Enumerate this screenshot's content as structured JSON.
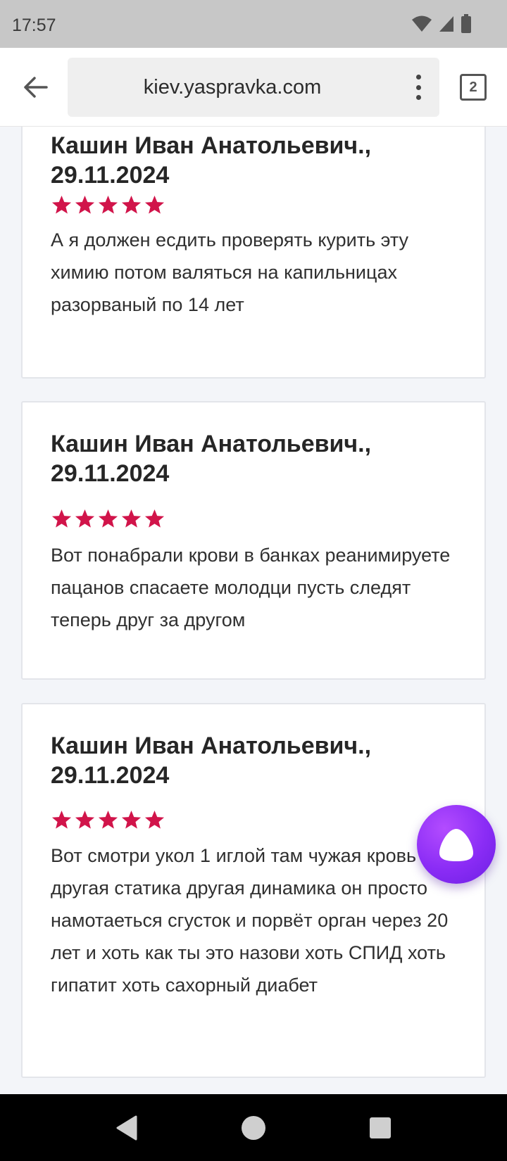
{
  "status_bar": {
    "time": "17:57",
    "icons": [
      "wifi-icon",
      "signal-icon",
      "battery-icon"
    ]
  },
  "browser": {
    "url": "kiev.yaspravka.com",
    "tab_count": "2"
  },
  "reviews": [
    {
      "author": "Кашин Иван Анатольевич., 29.11.2024",
      "rating": 5,
      "text": "А я должен есдить проверять курить эту химию потом валяться на капильницах разорваный по 14 лет"
    },
    {
      "author": "Кашин Иван Анатольевич., 29.11.2024",
      "rating": 5,
      "text": "Вот понабрали крови в банках реанимируете пацанов спасаете молодци пусть следят теперь друг за другом"
    },
    {
      "author": "Кашин Иван Анатольевич., 29.11.2024",
      "rating": 5,
      "text": "Вот смотри укол 1 иглой там чужая кровь другая статика другая динамика он просто намотаеться сгусток и порвёт орган через 20 лет и хоть как ты это назови хоть СПИД хоть гипатит хоть сахорный диабет"
    }
  ],
  "colors": {
    "star": "#d1144a",
    "assistant_button": "#8a2cf5",
    "status_bar": "#c7c7c7"
  }
}
